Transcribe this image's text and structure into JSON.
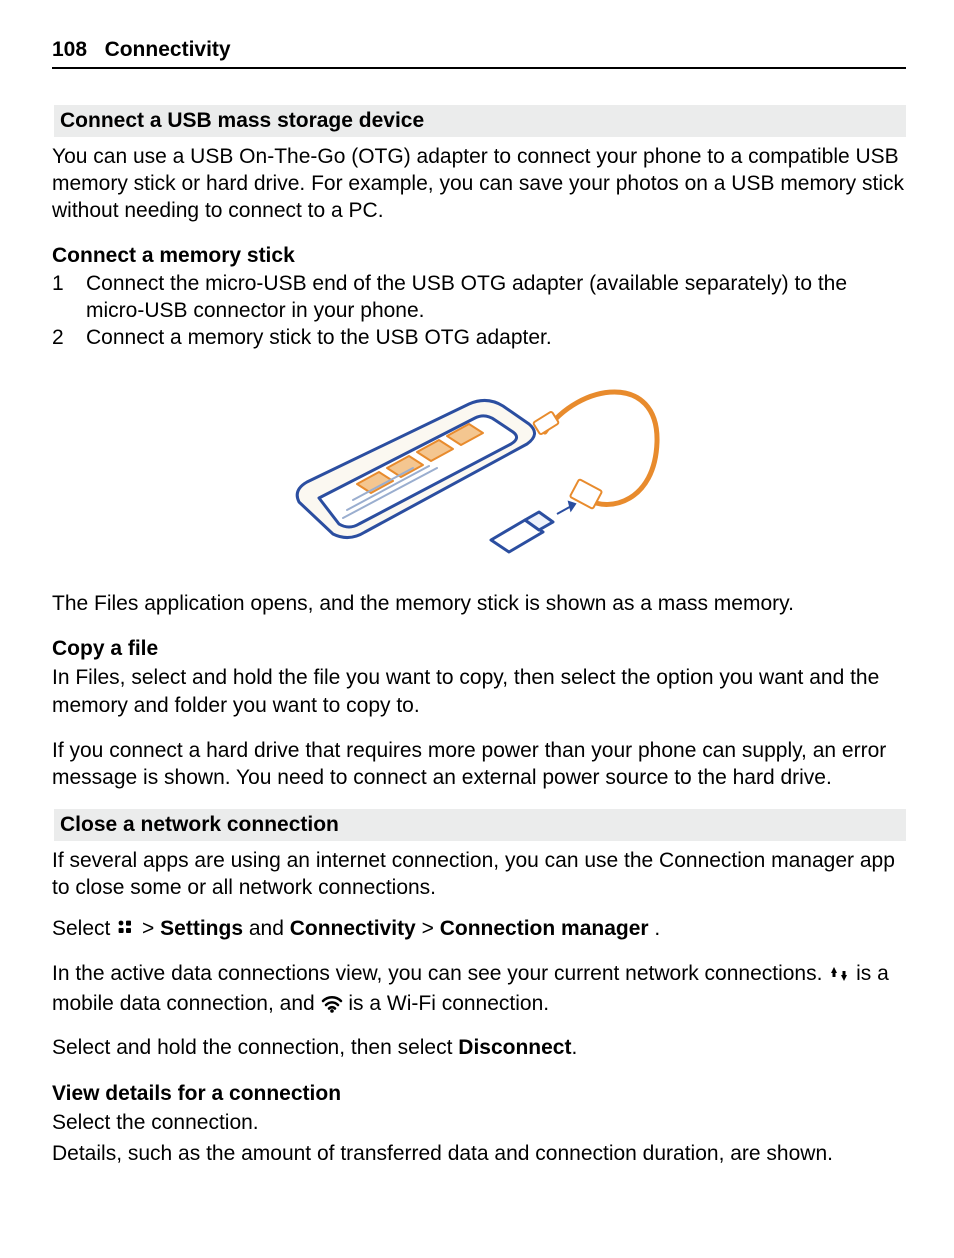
{
  "header": {
    "page_number": "108",
    "chapter": "Connectivity"
  },
  "sec1": {
    "title": "Connect a USB mass storage device",
    "intro": "You can use a USB On-The-Go (OTG) adapter to connect your phone to a compatible USB memory stick or hard drive. For example, you can save your photos on a USB memory stick without needing to connect to a PC.",
    "sub_memstick": "Connect a memory stick",
    "steps": [
      "Connect the micro-USB end of the USB OTG adapter (available separately) to the micro-USB connector in your phone.",
      "Connect a memory stick to the USB OTG adapter."
    ],
    "after_fig": "The Files application opens, and the memory stick is shown as a mass memory.",
    "sub_copy": "Copy a file",
    "copy_body": "In Files, select and hold the file you want to copy, then select the option you want and the memory and folder you want to copy to.",
    "power_note": "If you connect a hard drive that requires more power than your phone can supply, an error message is shown. You need to connect an external power source to the hard drive."
  },
  "sec2": {
    "title": "Close a network connection",
    "intro": "If several apps are using an internet connection, you can use the Connection manager app to close some or all network connections.",
    "select_line": {
      "prefix": "Select ",
      "gt1": " > ",
      "settings": "Settings",
      "and": " and ",
      "connectivity": "Connectivity",
      "gt2": "  > ",
      "connmgr": "Connection manager",
      "period": "."
    },
    "active_line": {
      "a": "In the active data connections view, you can see your current network connections. ",
      "b": " is a mobile data connection, and ",
      "c": " is a Wi-Fi connection."
    },
    "disconnect_pre": "Select and hold the connection, then select ",
    "disconnect_kw": "Disconnect",
    "disconnect_post": ".",
    "sub_view": "View details for a connection",
    "view_l1": "Select the connection.",
    "view_l2": "Details, such as the amount of transferred data and connection duration, are shown."
  },
  "icons": {
    "menu": "menu-grid-icon",
    "mobile": "mobile-data-icon",
    "wifi": "wifi-icon"
  }
}
